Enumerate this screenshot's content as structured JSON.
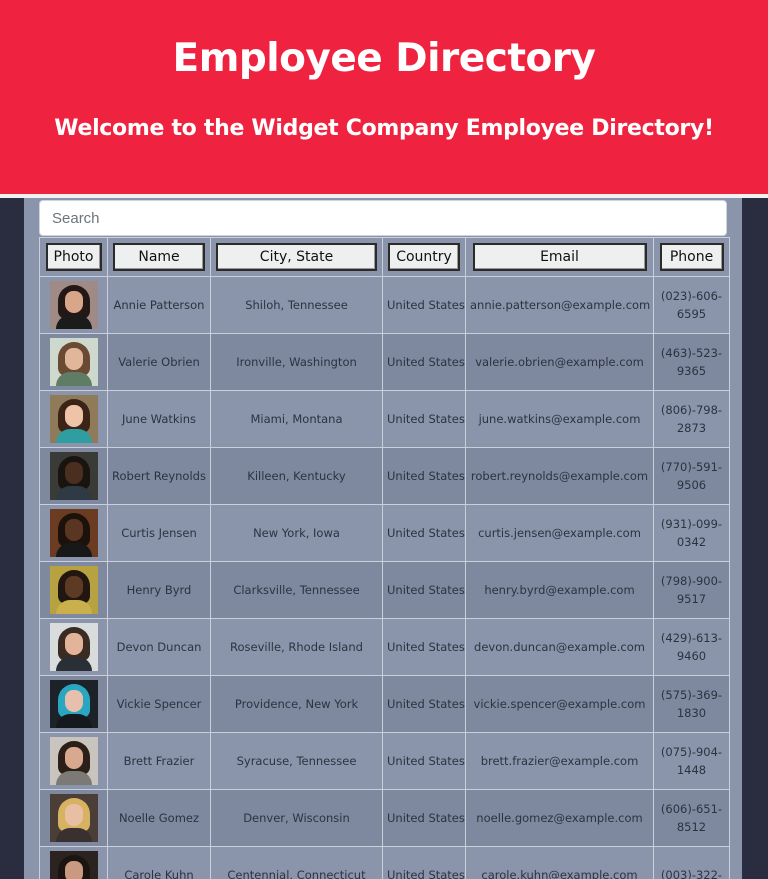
{
  "header": {
    "title": "Employee Directory",
    "subtitle": "Welcome to the Widget Company Employee Directory!"
  },
  "search": {
    "placeholder": "Search",
    "value": ""
  },
  "table": {
    "columns": [
      "Photo",
      "Name",
      "City, State",
      "Country",
      "Email",
      "Phone"
    ],
    "rows": [
      {
        "name": "Annie Patterson",
        "location": "Shiloh, Tennessee",
        "country": "United States",
        "email": "annie.patterson@example.com",
        "phone": "(023)-606-6595",
        "photo": {
          "bg": "#a08a86",
          "hair": "#231815",
          "skin": "#d9a68a",
          "shirt": "#1b1b1b"
        }
      },
      {
        "name": "Valerie Obrien",
        "location": "Ironville, Washington",
        "country": "United States",
        "email": "valerie.obrien@example.com",
        "phone": "(463)-523-9365",
        "photo": {
          "bg": "#cfd8cc",
          "hair": "#6b4a33",
          "skin": "#e1b79c",
          "shirt": "#5f7d64"
        }
      },
      {
        "name": "June Watkins",
        "location": "Miami, Montana",
        "country": "United States",
        "email": "june.watkins@example.com",
        "phone": "(806)-798-2873",
        "photo": {
          "bg": "#8f7a5a",
          "hair": "#3a2418",
          "skin": "#efc3a8",
          "shirt": "#2e9ea0"
        }
      },
      {
        "name": "Robert Reynolds",
        "location": "Killeen, Kentucky",
        "country": "United States",
        "email": "robert.reynolds@example.com",
        "phone": "(770)-591-9506",
        "photo": {
          "bg": "#3a3a36",
          "hair": "#1a1410",
          "skin": "#4a2e1f",
          "shirt": "#2f3a45"
        }
      },
      {
        "name": "Curtis Jensen",
        "location": "New York, Iowa",
        "country": "United States",
        "email": "curtis.jensen@example.com",
        "phone": "(931)-099-0342",
        "photo": {
          "bg": "#6b3b22",
          "hair": "#1c120c",
          "skin": "#5a3522",
          "shirt": "#181818"
        }
      },
      {
        "name": "Henry Byrd",
        "location": "Clarksville, Tennessee",
        "country": "United States",
        "email": "henry.byrd@example.com",
        "phone": "(798)-900-9517",
        "photo": {
          "bg": "#b7a241",
          "hair": "#221611",
          "skin": "#5c3a24",
          "shirt": "#c9b04d"
        }
      },
      {
        "name": "Devon Duncan",
        "location": "Roseville, Rhode Island",
        "country": "United States",
        "email": "devon.duncan@example.com",
        "phone": "(429)-613-9460",
        "photo": {
          "bg": "#d9dcdc",
          "hair": "#3a2c22",
          "skin": "#e2b59a",
          "shirt": "#2a2e36"
        }
      },
      {
        "name": "Vickie Spencer",
        "location": "Providence, New York",
        "country": "United States",
        "email": "vickie.spencer@example.com",
        "phone": "(575)-369-1830",
        "photo": {
          "bg": "#1d2228",
          "hair": "#2aa7c0",
          "skin": "#e7c0ad",
          "shirt": "#15191e"
        }
      },
      {
        "name": "Brett Frazier",
        "location": "Syracuse, Tennessee",
        "country": "United States",
        "email": "brett.frazier@example.com",
        "phone": "(075)-904-1448",
        "photo": {
          "bg": "#c9c4bd",
          "hair": "#2b1f18",
          "skin": "#d8a98f",
          "shirt": "#7c7a76"
        }
      },
      {
        "name": "Noelle Gomez",
        "location": "Denver, Wisconsin",
        "country": "United States",
        "email": "noelle.gomez@example.com",
        "phone": "(606)-651-8512",
        "photo": {
          "bg": "#4b3e36",
          "hair": "#d6b262",
          "skin": "#e9bfa3",
          "shirt": "#3a3030"
        }
      },
      {
        "name": "Carole Kuhn",
        "location": "Centennial, Connecticut",
        "country": "United States",
        "email": "carole.kuhn@example.com",
        "phone": "(003)-322-",
        "photo": {
          "bg": "#2b2320",
          "hair": "#1b1411",
          "skin": "#c99a80",
          "shirt": "#2b2b2b"
        }
      }
    ]
  }
}
